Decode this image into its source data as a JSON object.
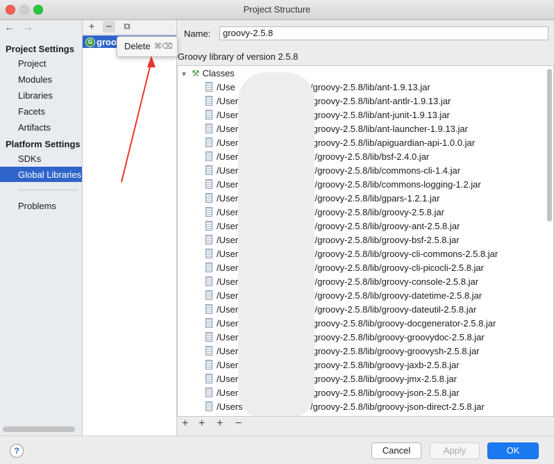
{
  "window": {
    "title": "Project Structure"
  },
  "nav": {
    "back": "←",
    "forward": "→",
    "project_settings": "Project Settings",
    "project_items": [
      "Project",
      "Modules",
      "Libraries",
      "Facets",
      "Artifacts"
    ],
    "platform_settings": "Platform Settings",
    "platform_items": [
      "SDKs",
      "Global Libraries"
    ],
    "selected_item": "Global Libraries",
    "other_items": [
      "Problems"
    ]
  },
  "libraries": {
    "toolbar": {
      "add": "+",
      "remove": "−",
      "copy": "⧉"
    },
    "selected_name": "groovy",
    "icon": "groovy-library-icon"
  },
  "context_menu": {
    "label": "Delete",
    "shortcut": "⌘⌫"
  },
  "detail": {
    "name_label": "Name:",
    "name_value": "groovy-2.5.8",
    "subtitle": "Groovy library of version 2.5.8",
    "root_label": "Classes",
    "rows": [
      {
        "prefix": "/Use",
        "path": "/groovy-2.5.8/lib/ant-1.9.13.jar"
      },
      {
        "prefix": "/User",
        "path": "/groovy-2.5.8/lib/ant-antlr-1.9.13.jar"
      },
      {
        "prefix": "/User",
        "path": "/groovy-2.5.8/lib/ant-junit-1.9.13.jar"
      },
      {
        "prefix": "/Users",
        "path": "/groovy-2.5.8/lib/ant-launcher-1.9.13.jar"
      },
      {
        "prefix": "/Users",
        "path": "/groovy-2.5.8/lib/apiguardian-api-1.0.0.jar"
      },
      {
        "prefix": "/Users",
        "path": "v/groovy-2.5.8/lib/bsf-2.4.0.jar"
      },
      {
        "prefix": "/Users",
        "path": "v/groovy-2.5.8/lib/commons-cli-1.4.jar"
      },
      {
        "prefix": "/Users",
        "path": "v/groovy-2.5.8/lib/commons-logging-1.2.jar"
      },
      {
        "prefix": "/Users",
        "path": "v/groovy-2.5.8/lib/gpars-1.2.1.jar"
      },
      {
        "prefix": "/Users",
        "path": "v/groovy-2.5.8/lib/groovy-2.5.8.jar"
      },
      {
        "prefix": "/Users",
        "path": "v/groovy-2.5.8/lib/groovy-ant-2.5.8.jar"
      },
      {
        "prefix": "/Users",
        "path": "v/groovy-2.5.8/lib/groovy-bsf-2.5.8.jar"
      },
      {
        "prefix": "/Users",
        "path": "v/groovy-2.5.8/lib/groovy-cli-commons-2.5.8.jar"
      },
      {
        "prefix": "/Users",
        "path": "v/groovy-2.5.8/lib/groovy-cli-picocli-2.5.8.jar"
      },
      {
        "prefix": "/Users",
        "path": "v/groovy-2.5.8/lib/groovy-console-2.5.8.jar"
      },
      {
        "prefix": "/Users",
        "path": "v/groovy-2.5.8/lib/groovy-datetime-2.5.8.jar"
      },
      {
        "prefix": "/Users",
        "path": "v/groovy-2.5.8/lib/groovy-dateutil-2.5.8.jar"
      },
      {
        "prefix": "/User",
        "path": "/groovy-2.5.8/lib/groovy-docgenerator-2.5.8.jar"
      },
      {
        "prefix": "/User",
        "path": "/groovy-2.5.8/lib/groovy-groovydoc-2.5.8.jar"
      },
      {
        "prefix": "/User",
        "path": "/groovy-2.5.8/lib/groovy-groovysh-2.5.8.jar"
      },
      {
        "prefix": "/User",
        "path": "/groovy-2.5.8/lib/groovy-jaxb-2.5.8.jar"
      },
      {
        "prefix": "/Users",
        "path": "/groovy-2.5.8/lib/groovy-jmx-2.5.8.jar"
      },
      {
        "prefix": "/Users",
        "path": "/groovy-2.5.8/lib/groovy-json-2.5.8.jar"
      },
      {
        "prefix": "/Users",
        "path": "/groovy-2.5.8/lib/groovy-json-direct-2.5.8.jar"
      }
    ],
    "bottom_toolbar": [
      "+",
      "+",
      "+",
      "−"
    ]
  },
  "footer": {
    "help": "?",
    "cancel": "Cancel",
    "apply": "Apply",
    "ok": "OK"
  },
  "colors": {
    "selection": "#2f65ca",
    "ok_button": "#1b7af0",
    "annotation_arrow": "#e8362c"
  }
}
